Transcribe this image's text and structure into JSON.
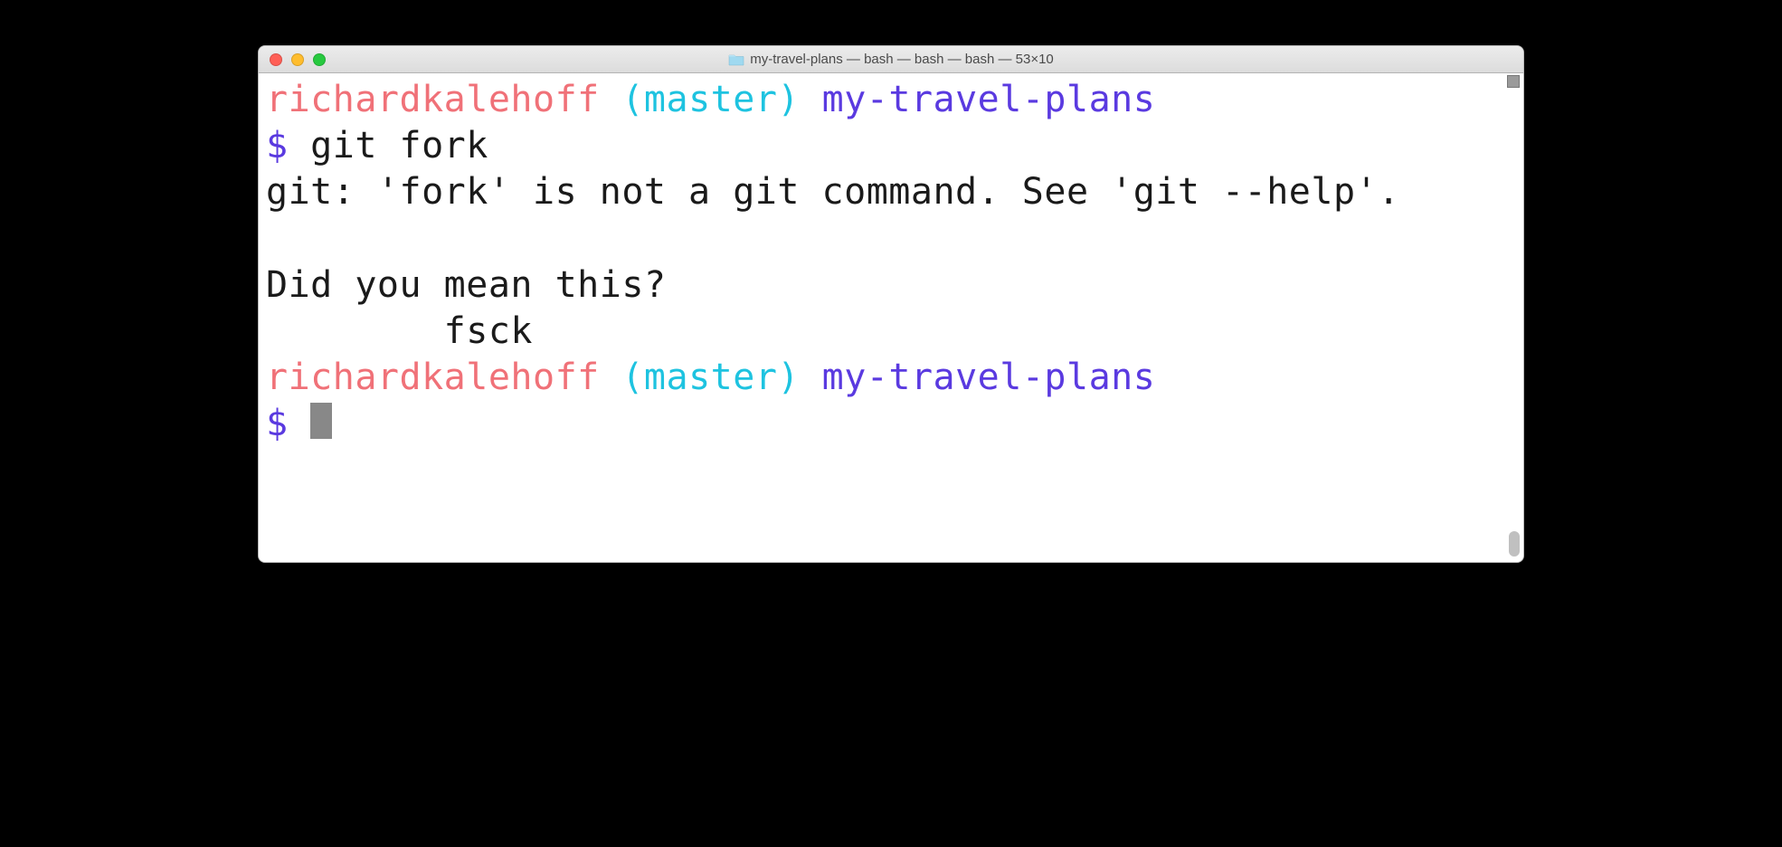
{
  "titlebar": {
    "title": "my-travel-plans — bash — bash — bash — 53×10"
  },
  "prompt": {
    "user": "richardkalehoff",
    "branch_open": "(",
    "branch": "master",
    "branch_close": ")",
    "dir": "my-travel-plans",
    "symbol": "$"
  },
  "session": {
    "command1": " git fork",
    "error_line": "git: 'fork' is not a git command. See 'git --help'.",
    "blank": "",
    "suggest_q": "Did you mean this?",
    "suggest_item": "\tfsck"
  }
}
